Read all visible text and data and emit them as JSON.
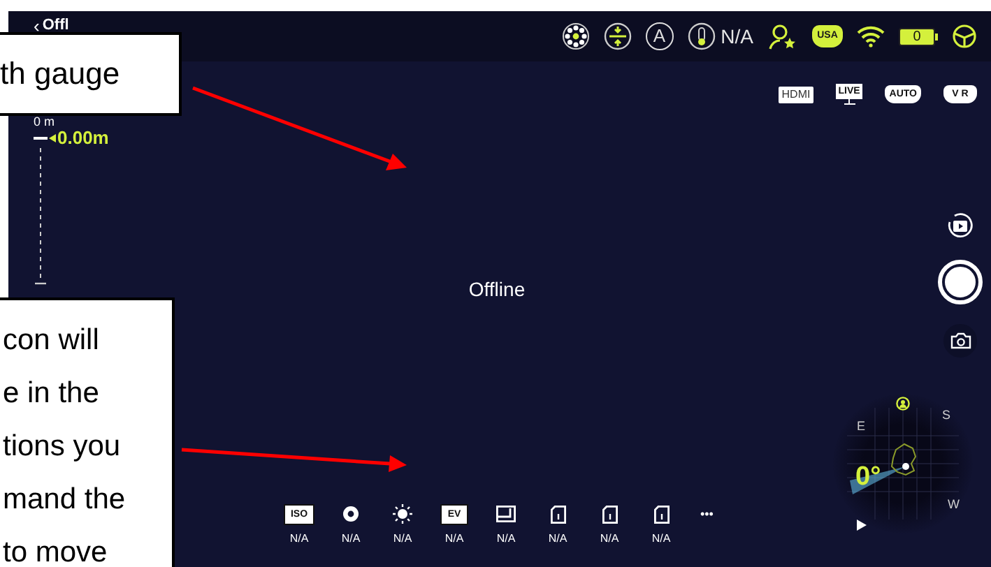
{
  "top_bar": {
    "back": "‹",
    "title": "Offl",
    "status_icons": [
      {
        "kind": "lights"
      },
      {
        "kind": "level"
      },
      {
        "kind": "letter",
        "text": "A"
      },
      {
        "kind": "thermometer",
        "text": "N/A"
      },
      {
        "kind": "pilot"
      },
      {
        "kind": "controller",
        "text": "USA"
      },
      {
        "kind": "wifi"
      },
      {
        "kind": "battery",
        "text": "0"
      },
      {
        "kind": "wheel"
      }
    ]
  },
  "depth_gauge": {
    "scale_label": "0 m",
    "reading": "0.00m"
  },
  "mode_badges": [
    {
      "kind": "tag",
      "label": "HDMI"
    },
    {
      "kind": "monitor",
      "label": "LIVE"
    },
    {
      "kind": "gamepad",
      "label": "AUTO"
    },
    {
      "kind": "gamepad",
      "label": "V R"
    }
  ],
  "status_message": "Offline",
  "camera_settings": [
    {
      "kind": "text-box",
      "badge": "ISO",
      "value": "N/A"
    },
    {
      "kind": "aperture",
      "value": "N/A"
    },
    {
      "kind": "brightness",
      "value": "N/A"
    },
    {
      "kind": "text-box",
      "badge": "EV",
      "value": "N/A"
    },
    {
      "kind": "frame",
      "value": "N/A"
    },
    {
      "kind": "card",
      "value": "N/A"
    },
    {
      "kind": "card",
      "value": "N/A"
    },
    {
      "kind": "card",
      "value": "N/A"
    }
  ],
  "more_button": "•••",
  "compass": {
    "heading": "0°",
    "directions": [
      "E",
      "S",
      "W"
    ]
  },
  "callouts": [
    {
      "lines": [
        "th gauge"
      ]
    },
    {
      "lines": [
        "con will",
        "e in the",
        "tions you",
        "mand the",
        "to move"
      ]
    }
  ]
}
